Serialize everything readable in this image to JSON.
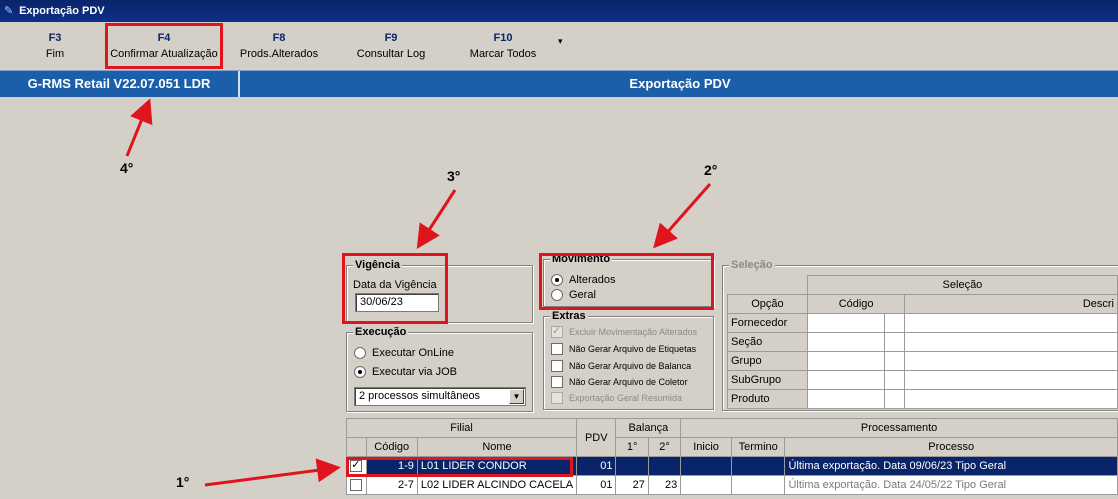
{
  "window": {
    "title": "Exportação PDV"
  },
  "toolbar": {
    "buttons": [
      {
        "key": "F3",
        "label": "Fim"
      },
      {
        "key": "F4",
        "label": "Confirmar Atualização"
      },
      {
        "key": "F8",
        "label": "Prods.Alterados"
      },
      {
        "key": "F9",
        "label": "Consultar Log"
      },
      {
        "key": "F10",
        "label": "Marcar Todos"
      }
    ],
    "more_icon": "▾"
  },
  "banner": {
    "version": "G-RMS Retail V22.07.051 LDR",
    "screen_title": "Exportação PDV"
  },
  "annotations": {
    "a1": "1°",
    "a2": "2°",
    "a3": "3°",
    "a4": "4°"
  },
  "vigencia": {
    "title": "Vigência",
    "label": "Data da Vigência",
    "value": "30/06/23"
  },
  "execucao": {
    "title": "Execução",
    "options": [
      {
        "label": "Executar OnLine",
        "selected": false
      },
      {
        "label": "Executar via JOB",
        "selected": true
      }
    ],
    "select_value": "2 processos simultâneos"
  },
  "movimento": {
    "title": "Movimento",
    "options": [
      {
        "label": "Alterados",
        "selected": true
      },
      {
        "label": "Geral",
        "selected": false
      }
    ]
  },
  "extras": {
    "title": "Extras",
    "items": [
      {
        "label": "Excluir Movimentação Alterados",
        "checked": true,
        "disabled": true
      },
      {
        "label": "Não Gerar Arquivo de Etiquetas",
        "checked": false,
        "disabled": false
      },
      {
        "label": "Não Gerar Arquivo de Balanca",
        "checked": false,
        "disabled": false
      },
      {
        "label": "Não Gerar Arquivo de Coletor",
        "checked": false,
        "disabled": false
      },
      {
        "label": "Exportação Geral Resumida",
        "checked": false,
        "disabled": true
      }
    ]
  },
  "selecao": {
    "title": "Seleção",
    "header": "Seleção",
    "columns": [
      "Opção",
      "Código",
      "Descri"
    ],
    "rows": [
      "Fornecedor",
      "Seção",
      "Grupo",
      "SubGrupo",
      "Produto"
    ]
  },
  "filial_grid": {
    "group_headers": {
      "filial": "Filial",
      "pdv": "PDV",
      "balanca": "Balança",
      "processamento": "Processamento"
    },
    "columns": {
      "codigo": "Código",
      "nome": "Nome",
      "b1": "1°",
      "b2": "2°",
      "inicio": "Inicio",
      "termino": "Termino",
      "processo": "Processo"
    },
    "rows": [
      {
        "checked": true,
        "codigo": "1-9",
        "nome": "L01 LIDER CONDOR",
        "pdv": "01",
        "b1": "",
        "b2": "",
        "inicio": "",
        "termino": "",
        "processo": "Última exportação. Data 09/06/23 Tipo Geral"
      },
      {
        "checked": false,
        "codigo": "2-7",
        "nome": "L02 LIDER ALCINDO CACELA",
        "pdv": "01",
        "b1": "27",
        "b2": "23",
        "inicio": "",
        "termino": "",
        "processo": "Última exportação. Data 24/05/22 Tipo Geral"
      }
    ]
  }
}
